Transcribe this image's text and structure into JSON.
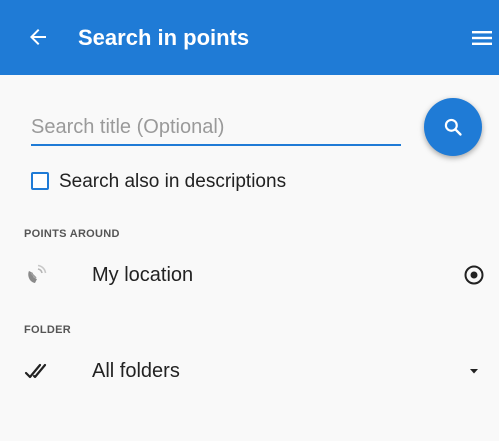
{
  "app": {
    "title": "Search in points",
    "accent_color": "#1f7bd6"
  },
  "toolbar": {
    "back_icon": "arrow-left-icon",
    "menu_icon": "hamburger-menu-icon"
  },
  "search": {
    "placeholder": "Search title (Optional)",
    "value": "",
    "button_icon": "search-icon"
  },
  "options": {
    "search_descriptions_label": "Search also in descriptions",
    "search_descriptions_checked": false
  },
  "points_around": {
    "header": "POINTS AROUND",
    "label": "My location",
    "icon": "location-signal-icon",
    "action_icon": "target-icon"
  },
  "folder": {
    "header": "FOLDER",
    "label": "All folders",
    "icon": "double-check-icon",
    "action_icon": "dropdown-arrow-icon"
  }
}
